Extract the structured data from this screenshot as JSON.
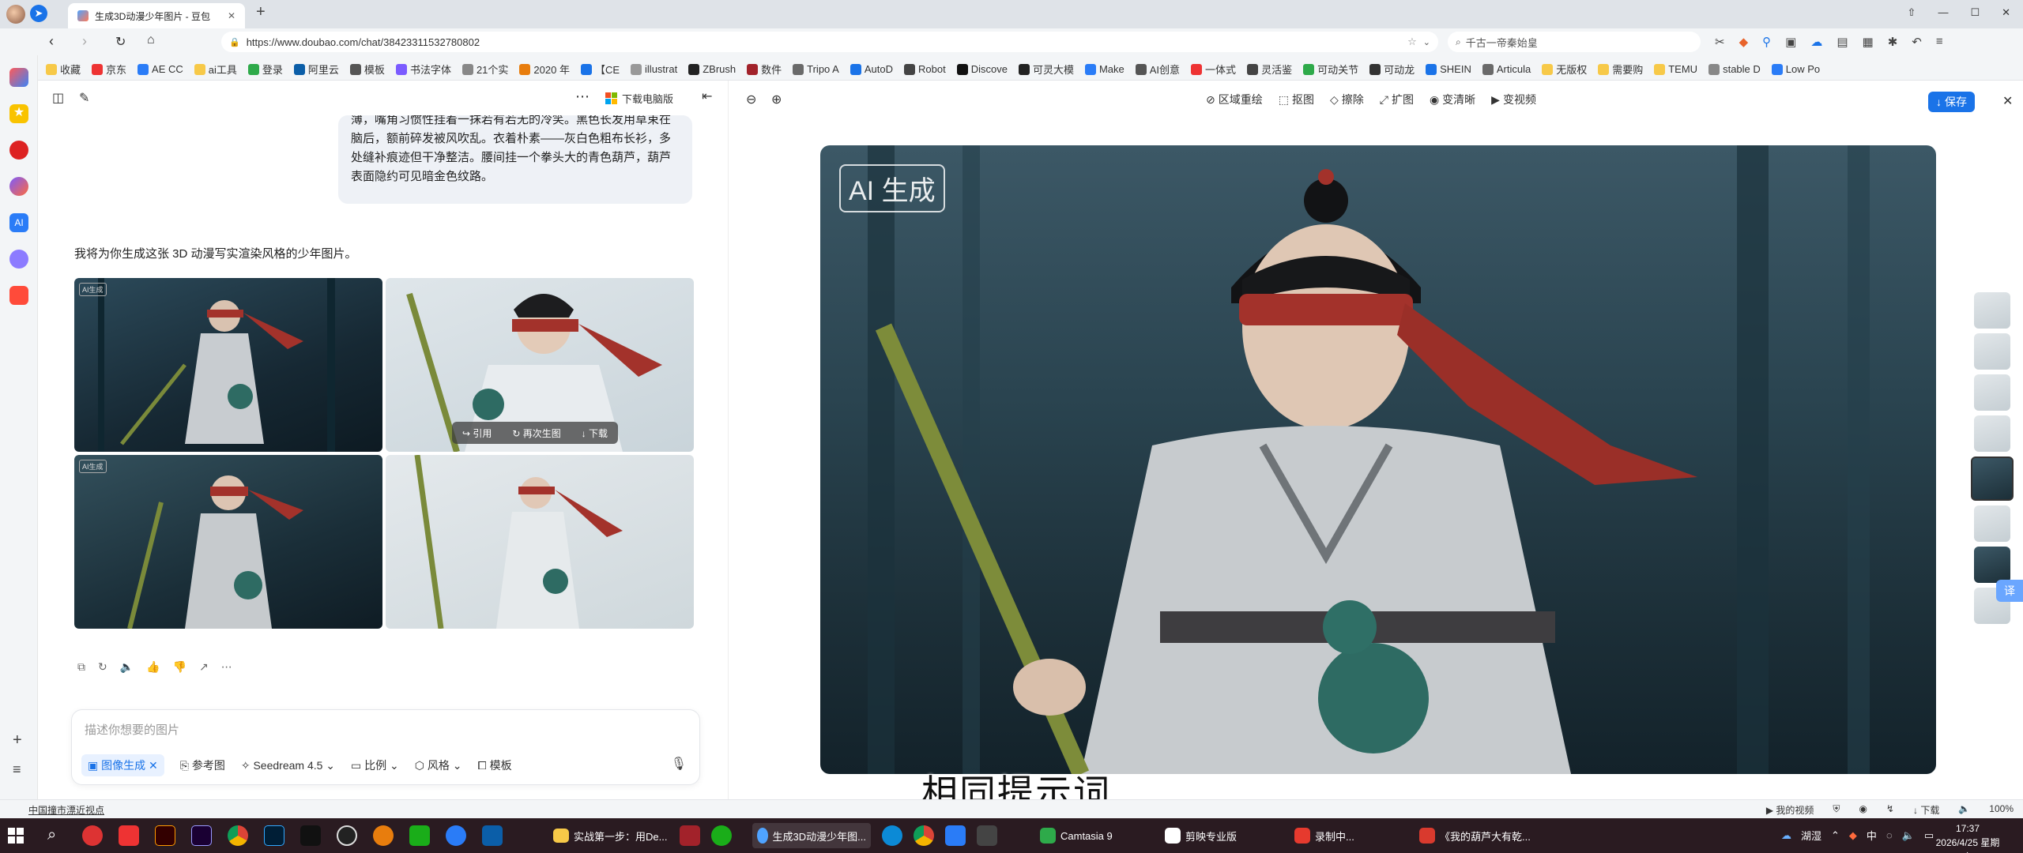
{
  "browser": {
    "tab_title": "生成3D动漫少年图片 - 豆包",
    "new_tab": "+",
    "url": "https://www.doubao.com/chat/38423311532780802",
    "search_placeholder": "千古一帝秦始皇",
    "window_controls": [
      "—",
      "☐",
      "✕"
    ]
  },
  "bookmarks": [
    "收藏",
    "京东",
    "AE CC",
    "ai工具",
    "登录",
    "阿里云",
    "模板",
    "书法字体",
    "21个实",
    "2020 年",
    "【CE",
    "illustrat",
    "ZBrush",
    "数件",
    "Tripo A",
    "AutoD",
    "Robot",
    "Discove",
    "可灵大模",
    "Make",
    "AI创意",
    "一体式",
    "灵活鉴",
    "可动关节",
    "可动龙",
    "SHEIN",
    "Articula",
    "无版权",
    "需要购",
    "TEMU",
    "stable D",
    "Low Po"
  ],
  "chat": {
    "toolbar_download": "下载电脑版",
    "user_message": "薄，嘴角习惯性挂着一抹若有若无的冷笑。黑色长发用草束在脑后，额前碎发被风吹乱。衣着朴素——灰白色粗布长衫，多处缝补痕迹但干净整洁。腰间挂一个拳头大的青色葫芦，葫芦表面隐约可见暗金色纹路。",
    "assistant_reply": "我将为你生成这张 3D 动漫写实渲染风格的少年图片。",
    "ai_badge": "AI生成",
    "hover_actions": [
      "引用",
      "再次生图",
      "下载"
    ],
    "input_placeholder": "描述你想要的图片",
    "input_chips": {
      "mode": "图像生成",
      "ref": "参考图",
      "model": "Seedream 4.5",
      "ratio": "比例",
      "style": "风格",
      "template": "模板"
    }
  },
  "viewer": {
    "tools": [
      "区域重绘",
      "抠图",
      "擦除",
      "扩图",
      "变清晰",
      "变视频"
    ],
    "save": "保存",
    "watermark": "AI 生成",
    "subtitle": "相同提示词",
    "translate": "译"
  },
  "statusbar": {
    "left": "中国撞市漂近视点",
    "right_items": [
      "我的视频",
      "下载",
      "100%"
    ]
  },
  "taskbar": {
    "apps": [
      "实战第一步：用De...",
      "生成3D动漫少年图...",
      "Camtasia 9",
      "剪映专业版",
      "录制中..."
    ],
    "last_app": "《我的葫芦大有乾...",
    "tray_text": "湖湿",
    "tray_input": "中",
    "time": "17:37",
    "date": "2026/4/25 星期六"
  },
  "colors": {
    "accent": "#1a73e8",
    "taskbar": "#2a1b21",
    "scarf": "#a3322b"
  }
}
